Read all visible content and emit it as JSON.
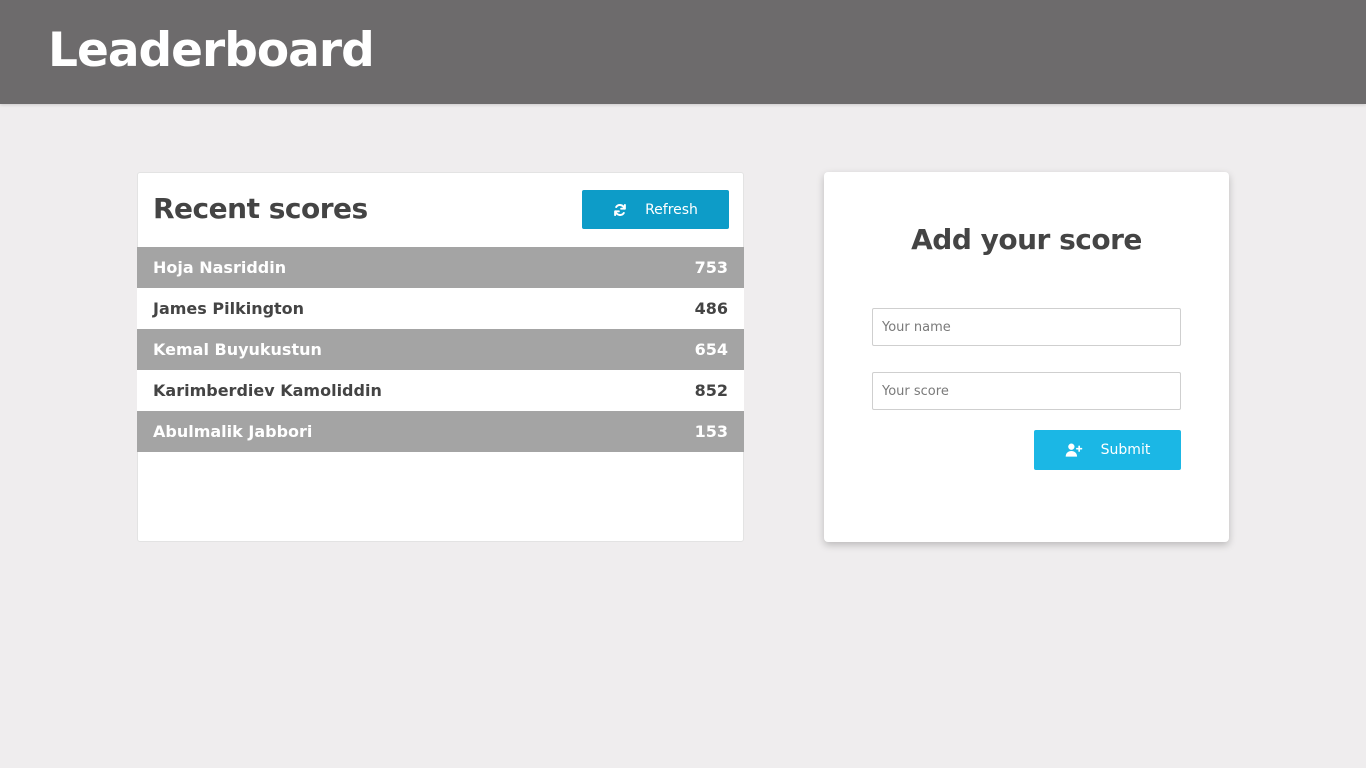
{
  "header": {
    "title": "Leaderboard"
  },
  "scores_panel": {
    "title": "Recent scores",
    "refresh_label": "Refresh",
    "refresh_icon": "sync-icon",
    "entries": [
      {
        "name": "Hoja Nasriddin",
        "score": "753"
      },
      {
        "name": "James Pilkington",
        "score": "486"
      },
      {
        "name": "Kemal Buyukustun",
        "score": "654"
      },
      {
        "name": "Karimberdiev Kamoliddin",
        "score": "852"
      },
      {
        "name": "Abulmalik Jabbori",
        "score": "153"
      }
    ]
  },
  "add_panel": {
    "title": "Add your score",
    "name_placeholder": "Your name",
    "name_value": "",
    "score_placeholder": "Your score",
    "score_value": "",
    "submit_label": "Submit",
    "submit_icon": "user-plus-icon"
  },
  "colors": {
    "header_bg": "#6d6b6c",
    "page_bg": "#efedee",
    "refresh_button": "#0d9cc8",
    "submit_button": "#1bb7e5",
    "striped_row": "#a4a4a4",
    "text": "#444444"
  }
}
